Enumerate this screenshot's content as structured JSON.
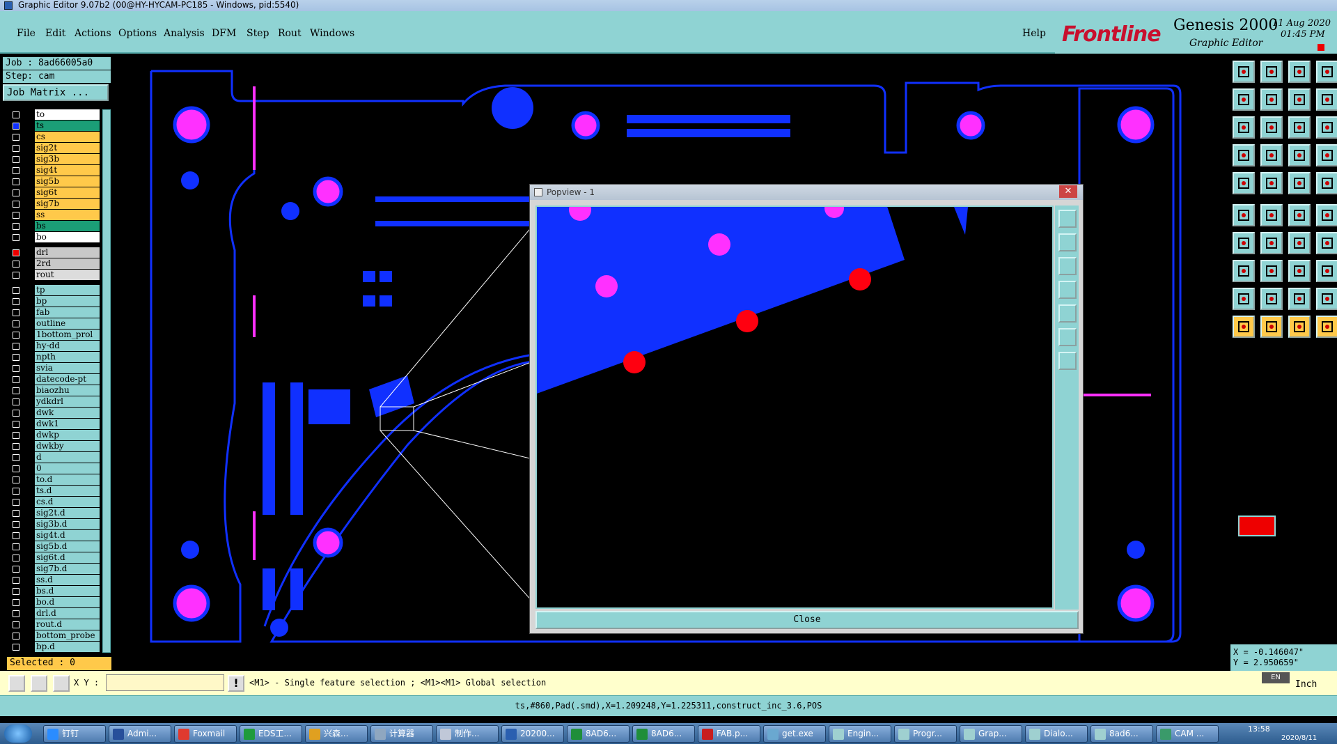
{
  "window": {
    "title": "Graphic Editor 9.07b2 (00@HY-HYCAM-PC185 - Windows, pid:5540)"
  },
  "menu": {
    "items": [
      "File",
      "Edit",
      "Actions",
      "Options",
      "Analysis",
      "DFM",
      "Step",
      "Rout",
      "Windows"
    ],
    "help": "Help"
  },
  "brand": {
    "logo": "Frontline",
    "product": "Genesis 2000",
    "subtitle": "Graphic Editor",
    "date": "11 Aug 2020",
    "time": "01:45 PM"
  },
  "job": {
    "job_label": "Job : 8ad66005a0",
    "step_label": "Step: cam",
    "matrix_button": "Job Matrix ..."
  },
  "layers": [
    {
      "name": "to",
      "color": "#ffffff",
      "state": "off"
    },
    {
      "name": "ts",
      "color": "#1b9e77",
      "state": "on"
    },
    {
      "name": "cs",
      "color": "#ffc94a",
      "state": "off"
    },
    {
      "name": "sig2t",
      "color": "#ffc94a",
      "state": "off"
    },
    {
      "name": "sig3b",
      "color": "#ffc94a",
      "state": "off"
    },
    {
      "name": "sig4t",
      "color": "#ffc94a",
      "state": "off"
    },
    {
      "name": "sig5b",
      "color": "#ffc94a",
      "state": "off"
    },
    {
      "name": "sig6t",
      "color": "#ffc94a",
      "state": "off"
    },
    {
      "name": "sig7b",
      "color": "#ffc94a",
      "state": "off"
    },
    {
      "name": "ss",
      "color": "#ffc94a",
      "state": "off"
    },
    {
      "name": "bs",
      "color": "#1b9e77",
      "state": "off"
    },
    {
      "name": "bo",
      "color": "#ffffff",
      "state": "off"
    },
    {
      "name": "drl",
      "color": "#c8c8c8",
      "state": "red"
    },
    {
      "name": "2rd",
      "color": "#c8c8c8",
      "state": "off"
    },
    {
      "name": "rout",
      "color": "#dcdcdc",
      "state": "off"
    },
    {
      "name": "tp",
      "color": "#8fd3d3",
      "state": "off"
    },
    {
      "name": "bp",
      "color": "#8fd3d3",
      "state": "off"
    },
    {
      "name": "fab",
      "color": "#8fd3d3",
      "state": "off"
    },
    {
      "name": "outline",
      "color": "#8fd3d3",
      "state": "off"
    },
    {
      "name": "1bottom_prol",
      "color": "#8fd3d3",
      "state": "off"
    },
    {
      "name": "hy-dd",
      "color": "#8fd3d3",
      "state": "off"
    },
    {
      "name": "npth",
      "color": "#8fd3d3",
      "state": "off"
    },
    {
      "name": "svia",
      "color": "#8fd3d3",
      "state": "off"
    },
    {
      "name": "datecode-pt",
      "color": "#8fd3d3",
      "state": "off"
    },
    {
      "name": "biaozhu",
      "color": "#8fd3d3",
      "state": "off"
    },
    {
      "name": "ydkdrl",
      "color": "#8fd3d3",
      "state": "off"
    },
    {
      "name": "dwk",
      "color": "#8fd3d3",
      "state": "off"
    },
    {
      "name": "dwk1",
      "color": "#8fd3d3",
      "state": "off"
    },
    {
      "name": "dwkp",
      "color": "#8fd3d3",
      "state": "off"
    },
    {
      "name": "dwkby",
      "color": "#8fd3d3",
      "state": "off"
    },
    {
      "name": "d",
      "color": "#8fd3d3",
      "state": "off"
    },
    {
      "name": "0",
      "color": "#8fd3d3",
      "state": "off"
    },
    {
      "name": "to.d",
      "color": "#8fd3d3",
      "state": "off"
    },
    {
      "name": "ts.d",
      "color": "#8fd3d3",
      "state": "off"
    },
    {
      "name": "cs.d",
      "color": "#8fd3d3",
      "state": "off"
    },
    {
      "name": "sig2t.d",
      "color": "#8fd3d3",
      "state": "off"
    },
    {
      "name": "sig3b.d",
      "color": "#8fd3d3",
      "state": "off"
    },
    {
      "name": "sig4t.d",
      "color": "#8fd3d3",
      "state": "off"
    },
    {
      "name": "sig5b.d",
      "color": "#8fd3d3",
      "state": "off"
    },
    {
      "name": "sig6t.d",
      "color": "#8fd3d3",
      "state": "off"
    },
    {
      "name": "sig7b.d",
      "color": "#8fd3d3",
      "state": "off"
    },
    {
      "name": "ss.d",
      "color": "#8fd3d3",
      "state": "off"
    },
    {
      "name": "bs.d",
      "color": "#8fd3d3",
      "state": "off"
    },
    {
      "name": "bo.d",
      "color": "#8fd3d3",
      "state": "off"
    },
    {
      "name": "drl.d",
      "color": "#8fd3d3",
      "state": "off"
    },
    {
      "name": "rout.d",
      "color": "#8fd3d3",
      "state": "off"
    },
    {
      "name": "bottom_probe",
      "color": "#8fd3d3",
      "state": "off"
    },
    {
      "name": "bp.d",
      "color": "#8fd3d3",
      "state": "off"
    }
  ],
  "selected": "Selected : 0",
  "coords": {
    "x": "X = -0.146047\"",
    "y": "Y = 2.950659\""
  },
  "status": {
    "xy_label": "X Y :",
    "xy_value": "",
    "prompt": "<M1> - Single feature selection ; <M1><M1> Global selection",
    "units": "Inch",
    "lang": "EN"
  },
  "info": "ts,#860,Pad(.smd),X=1.209248,Y=1.225311,construct_inc_3.6,POS",
  "popview": {
    "title": "Popview - 1",
    "close_label": "Close",
    "close_x": "✕"
  },
  "colors": {
    "accent": "#8fd3d3",
    "copper": "#1030ff",
    "pad": "#ff30ff",
    "drill": "#ff0010",
    "selected_layer": "#ffc94a"
  },
  "taskbar": [
    {
      "label": "钉钉",
      "icon_color": "#2a8cff"
    },
    {
      "label": "Admi...",
      "icon_color": "#274f9a"
    },
    {
      "label": "Foxmail",
      "icon_color": "#e03a2f"
    },
    {
      "label": "EDS工...",
      "icon_color": "#1f9b3b"
    },
    {
      "label": "兴森...",
      "icon_color": "#e0a020"
    },
    {
      "label": "计算器",
      "icon_color": "#8fa7c0"
    },
    {
      "label": "制作...",
      "icon_color": "#c0c8d8"
    },
    {
      "label": "20200...",
      "icon_color": "#2a5fb0"
    },
    {
      "label": "8AD6...",
      "icon_color": "#1f8e3a"
    },
    {
      "label": "8AD6...",
      "icon_color": "#1f8e3a"
    },
    {
      "label": "FAB.p...",
      "icon_color": "#c81e1e"
    },
    {
      "label": "get.exe",
      "icon_color": "#6aa8d0"
    },
    {
      "label": "Engin...",
      "icon_color": "#9fd0d0"
    },
    {
      "label": "Progr...",
      "icon_color": "#9fd0d0"
    },
    {
      "label": "Grap...",
      "icon_color": "#9fd0d0"
    },
    {
      "label": "Dialo...",
      "icon_color": "#9fd0d0"
    },
    {
      "label": "8ad6...",
      "icon_color": "#9fd0d0"
    },
    {
      "label": "CAM ...",
      "icon_color": "#3a9a6a"
    }
  ],
  "clock": {
    "time": "13:58",
    "date": "2020/8/11"
  }
}
